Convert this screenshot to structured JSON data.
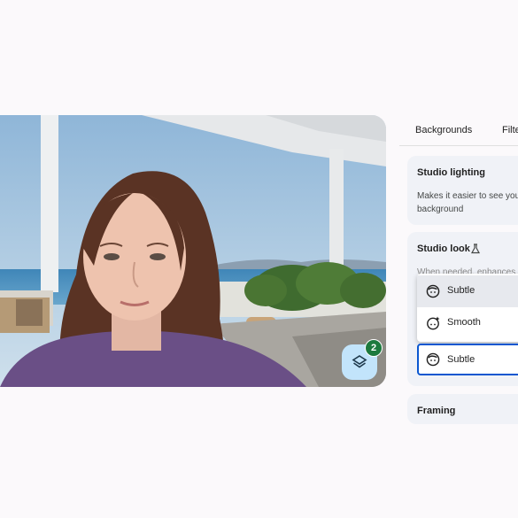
{
  "effects": {
    "badge_count": "2",
    "icon": "layers-icon"
  },
  "tabs": [
    {
      "label": "Backgrounds"
    },
    {
      "label": "Filte"
    }
  ],
  "cards": {
    "studio_lighting": {
      "title": "Studio lighting",
      "desc_line1": "Makes it easier to see you",
      "desc_line2": "background"
    },
    "studio_look": {
      "title": "Studio look",
      "icon": "flask-icon",
      "desc_partial": "When needed, enhances"
    },
    "framing": {
      "title": "Framing"
    }
  },
  "dropdown": {
    "options": [
      {
        "label": "Subtle",
        "icon": "face-icon"
      },
      {
        "label": "Smooth",
        "icon": "face-sparkle-icon"
      }
    ],
    "selected": "Subtle",
    "selected_option_index": 0
  },
  "colors": {
    "accent": "#0b57d0",
    "badge": "#1d7a3e",
    "effects_button": "#c2e4fb",
    "card": "#f0f2f7"
  }
}
